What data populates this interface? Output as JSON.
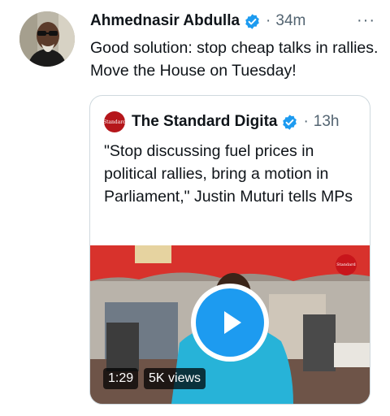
{
  "tweet": {
    "author": "Ahmednasir Abdulla",
    "separator": "·",
    "time": "34m",
    "more": "···",
    "text": "Good solution: stop cheap talks in rallies. Move the House on Tuesday!"
  },
  "quoted": {
    "logo_text": "Standard",
    "author": "The Standard Digita",
    "separator": "·",
    "time": "13h",
    "text": "\"Stop discussing fuel prices in political rallies, bring a motion in Parliament,\" Justin Muturi tells MPs",
    "video": {
      "duration": "1:29",
      "views": "5K views",
      "watermark": "Standard"
    }
  },
  "colors": {
    "verified": "#1d9bf0",
    "play": "#1d9bf0",
    "muted": "#536471",
    "border": "#cfd9de",
    "logo": "#b5161b"
  }
}
